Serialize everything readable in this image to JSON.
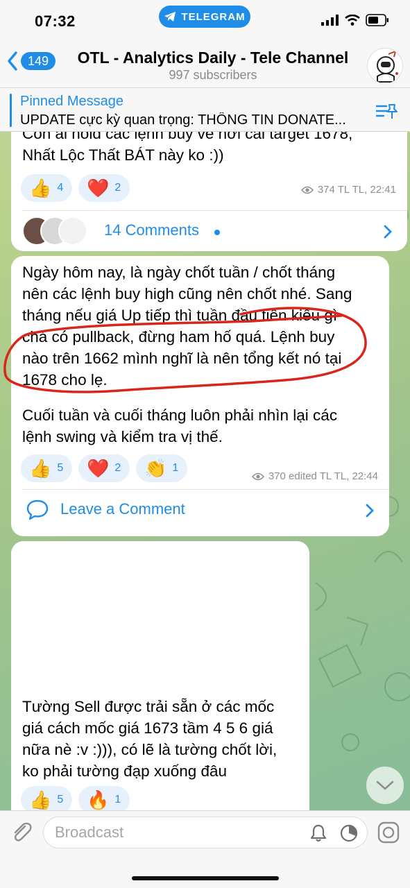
{
  "status": {
    "time": "07:32",
    "app_pill": "TELEGRAM"
  },
  "header": {
    "back_count": "149",
    "title": "OTL - Analytics Daily - Tele Channel",
    "subtitle": "997 subscribers"
  },
  "pinned": {
    "title": "Pinned Message",
    "text": "UPDATE cực kỳ quan trọng: THÔNG TIN DONATE..."
  },
  "posts": [
    {
      "text_lines": [
        "Còn ai hold các lệnh buy về hơi cái target 1678,",
        "Nhất Lộc Thất BÁT này ko :))"
      ],
      "reactions": [
        {
          "emoji": "👍",
          "count": "4"
        },
        {
          "emoji": "❤️",
          "count": "2"
        }
      ],
      "meta": "374 TL TL, 22:41",
      "comments": "14 Comments"
    },
    {
      "text_lines": [
        "Ngày hôm nay, là ngày chốt tuần / chốt tháng",
        "nên các lệnh buy high cũng nên chốt nhé. Sang",
        "tháng nếu giá Up tiếp thì tuần đầu tiên kiểu gì",
        "chả có pullback, đừng ham hố quá. Lệnh buy",
        "nào trên 1662 mình nghĩ là nên tổng kết nó tại",
        "1678 cho lẹ."
      ],
      "text_lines_2": [
        "Cuối tuần và cuối tháng luôn phải nhìn lại các",
        "lệnh swing và kiểm tra vị thế."
      ],
      "reactions": [
        {
          "emoji": "👍",
          "count": "5"
        },
        {
          "emoji": "❤️",
          "count": "2"
        },
        {
          "emoji": "👏",
          "count": "1"
        }
      ],
      "meta": "370 edited TL TL, 22:44",
      "comments": "Leave a Comment"
    },
    {
      "text_lines": [
        "Tường Sell được trải sẵn ở các mốc",
        "giá cách mốc giá 1673 tầm 4 5 6 giá",
        "nữa nè :v :))), có lẽ là tường chốt lời,",
        "ko phải tường đạp xuống đâu"
      ],
      "reactions": [
        {
          "emoji": "👍",
          "count": "5"
        },
        {
          "emoji": "🔥",
          "count": "1"
        }
      ]
    }
  ],
  "input": {
    "placeholder": "Broadcast"
  },
  "colors": {
    "accent": "#1f8de8",
    "annotation": "#d9261c"
  }
}
